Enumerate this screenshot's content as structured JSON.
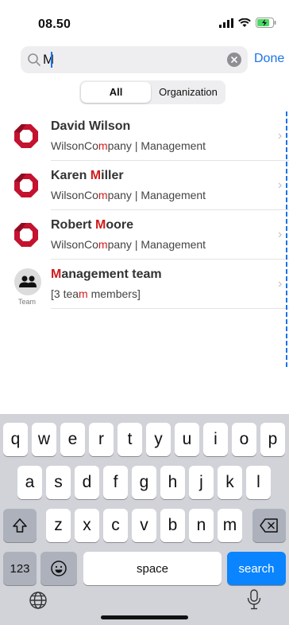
{
  "status": {
    "time": "08.50"
  },
  "search": {
    "query": "M",
    "done_label": "Done"
  },
  "tabs": [
    {
      "label": "All"
    },
    {
      "label": "Organization"
    }
  ],
  "results": [
    {
      "title_hl": "",
      "title_rest": "David Wilson",
      "title_hl2": "",
      "sub_a": "WilsonCo",
      "sub_hl": "m",
      "sub_b": "pany | Management"
    },
    {
      "title_pre": "Karen ",
      "title_hl": "M",
      "title_rest": "iller",
      "sub_a": "WilsonCo",
      "sub_hl": "m",
      "sub_b": "pany | Management"
    },
    {
      "title_pre": "Robert ",
      "title_hl": "M",
      "title_rest": "oore",
      "sub_a": "WilsonCo",
      "sub_hl": "m",
      "sub_b": "pany | Management"
    },
    {
      "title_pre": "",
      "title_hl": "M",
      "title_rest": "anagement team",
      "sub_a": "[3 tea",
      "sub_hl": "m",
      "sub_b": " members]",
      "tag": "Team"
    }
  ],
  "keyboard": {
    "row1": [
      "q",
      "w",
      "e",
      "r",
      "t",
      "y",
      "u",
      "i",
      "o",
      "p"
    ],
    "row2": [
      "a",
      "s",
      "d",
      "f",
      "g",
      "h",
      "j",
      "k",
      "l"
    ],
    "row3": [
      "z",
      "x",
      "c",
      "v",
      "b",
      "n",
      "m"
    ],
    "numbers": "123",
    "space": "space",
    "search": "search"
  },
  "colors": {
    "accent": "#1a73e8",
    "highlight": "#d01c1c",
    "brand": "#c4122f",
    "search_key": "#0a84ff"
  }
}
